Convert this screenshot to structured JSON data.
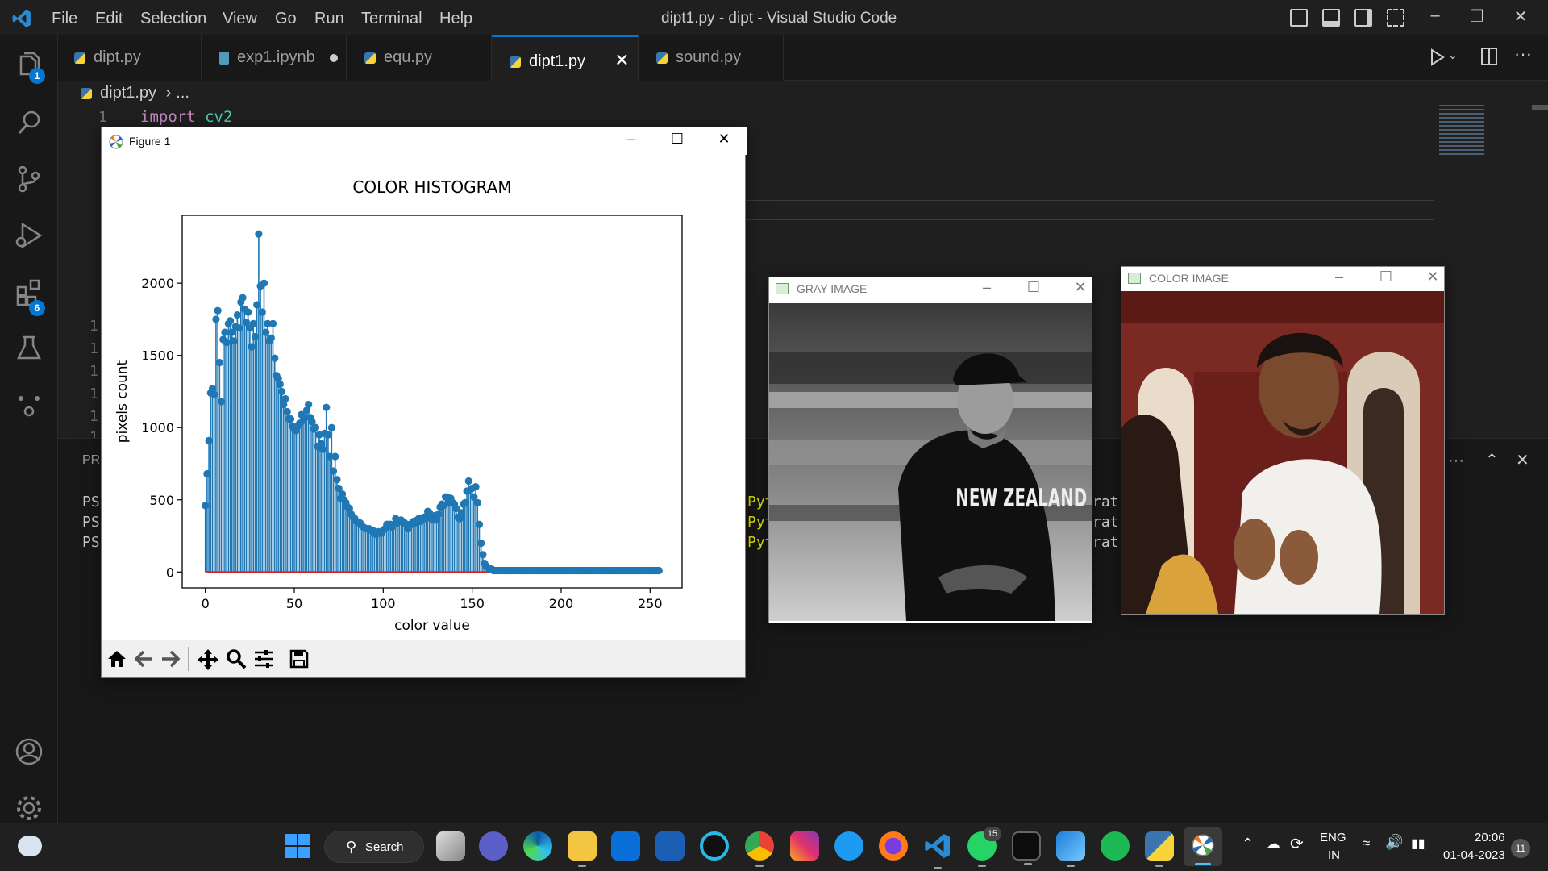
{
  "titlebar": {
    "menus": [
      "File",
      "Edit",
      "Selection",
      "View",
      "Go",
      "Run",
      "Terminal",
      "Help"
    ],
    "window_title": "dipt1.py - dipt - Visual Studio Code"
  },
  "activity": {
    "explorer_badge": "1",
    "extensions_badge": "6"
  },
  "tabs": [
    {
      "label": "dipt.py",
      "kind": "python"
    },
    {
      "label": "exp1.ipynb",
      "kind": "notebook",
      "dirty": true
    },
    {
      "label": "equ.py",
      "kind": "python"
    },
    {
      "label": "dipt1.py",
      "kind": "python",
      "active": true
    },
    {
      "label": "sound.py",
      "kind": "python"
    }
  ],
  "breadcrumb": {
    "file": "dipt1.py",
    "rest": "..."
  },
  "editor": {
    "line1_number": "1",
    "line1_keyword": "import",
    "line1_module": "cv2",
    "hidden_line_numbers": [
      "1",
      "1",
      "1",
      "1",
      "1",
      "1"
    ]
  },
  "panel": {
    "tab_prefix": "PR",
    "prompt_prefix": "PS",
    "py_fragment": "Pyt",
    "rat_fragment": "rat"
  },
  "figure": {
    "window_title": "Figure 1",
    "toolbar_icons": [
      "home-icon",
      "back-icon",
      "forward-icon",
      "pan-icon",
      "zoom-icon",
      "configure-icon",
      "save-icon"
    ]
  },
  "chart_data": {
    "type": "stem",
    "title": "COLOR HISTOGRAM",
    "xlabel": "color value",
    "ylabel": "pixels count",
    "xlim": [
      -13,
      268
    ],
    "ylim": [
      -110,
      2470
    ],
    "xticks": [
      0,
      50,
      100,
      150,
      200,
      250
    ],
    "yticks": [
      0,
      500,
      1000,
      1500,
      2000
    ],
    "stem_color": "#1f77b4",
    "baseline_color": "#d62728",
    "x": [
      0,
      1,
      2,
      3,
      4,
      5,
      6,
      7,
      8,
      9,
      10,
      11,
      12,
      13,
      14,
      15,
      16,
      17,
      18,
      19,
      20,
      21,
      22,
      23,
      24,
      25,
      26,
      27,
      28,
      29,
      30,
      31,
      32,
      33,
      34,
      35,
      36,
      37,
      38,
      39,
      40,
      41,
      42,
      43,
      44,
      45,
      46,
      47,
      48,
      49,
      50,
      51,
      52,
      53,
      54,
      55,
      56,
      57,
      58,
      59,
      60,
      61,
      62,
      63,
      64,
      65,
      66,
      67,
      68,
      69,
      70,
      71,
      72,
      73,
      74,
      75,
      76,
      77,
      78,
      79,
      80,
      81,
      82,
      83,
      84,
      85,
      86,
      87,
      88,
      89,
      90,
      91,
      92,
      93,
      94,
      95,
      96,
      97,
      98,
      99,
      100,
      101,
      102,
      103,
      104,
      105,
      106,
      107,
      108,
      109,
      110,
      111,
      112,
      113,
      114,
      115,
      116,
      117,
      118,
      119,
      120,
      121,
      122,
      123,
      124,
      125,
      126,
      127,
      128,
      129,
      130,
      131,
      132,
      133,
      134,
      135,
      136,
      137,
      138,
      139,
      140,
      141,
      142,
      143,
      144,
      145,
      146,
      147,
      148,
      149,
      150,
      151,
      152,
      153,
      154,
      155,
      156,
      157,
      158,
      159,
      160,
      161,
      162,
      163,
      164,
      165,
      166,
      167,
      168,
      169,
      170,
      171,
      172,
      173,
      174,
      175,
      176,
      177,
      178,
      179,
      180,
      181,
      182,
      183,
      184,
      185,
      186,
      187,
      188,
      189,
      190,
      191,
      192,
      193,
      194,
      195,
      196,
      197,
      198,
      199,
      200,
      201,
      202,
      203,
      204,
      205,
      206,
      207,
      208,
      209,
      210,
      211,
      212,
      213,
      214,
      215,
      216,
      217,
      218,
      219,
      220,
      221,
      222,
      223,
      224,
      225,
      226,
      227,
      228,
      229,
      230,
      231,
      232,
      233,
      234,
      235,
      236,
      237,
      238,
      239,
      240,
      241,
      242,
      243,
      244,
      245,
      246,
      247,
      248,
      249,
      250,
      251,
      252,
      253,
      254,
      255
    ],
    "y": [
      460,
      680,
      910,
      1240,
      1270,
      1230,
      1750,
      1810,
      1450,
      1180,
      1610,
      1660,
      1590,
      1720,
      1740,
      1660,
      1600,
      1700,
      1780,
      1690,
      1870,
      1900,
      1820,
      1730,
      1800,
      1690,
      1560,
      1720,
      1630,
      1850,
      2340,
      1980,
      1800,
      2000,
      1660,
      1720,
      1600,
      1620,
      1720,
      1480,
      1360,
      1340,
      1300,
      1250,
      1160,
      1200,
      1110,
      1060,
      1060,
      1010,
      990,
      980,
      1010,
      1030,
      1090,
      1050,
      1070,
      1120,
      1160,
      1070,
      1040,
      990,
      1000,
      870,
      950,
      890,
      850,
      960,
      1140,
      950,
      800,
      1000,
      700,
      800,
      640,
      580,
      510,
      540,
      500,
      480,
      450,
      440,
      400,
      380,
      370,
      350,
      340,
      340,
      320,
      310,
      300,
      300,
      300,
      290,
      290,
      270,
      260,
      280,
      270,
      270,
      290,
      300,
      330,
      330,
      330,
      310,
      330,
      370,
      340,
      350,
      360,
      350,
      340,
      330,
      300,
      330,
      330,
      350,
      340,
      360,
      370,
      350,
      370,
      380,
      370,
      420,
      410,
      370,
      360,
      390,
      360,
      400,
      450,
      470,
      460,
      520,
      520,
      480,
      510,
      480,
      470,
      440,
      380,
      370,
      410,
      470,
      480,
      560,
      630,
      570,
      580,
      520,
      590,
      480,
      330,
      200,
      120,
      60,
      40,
      30,
      20,
      20,
      10,
      10,
      10,
      10,
      10,
      10,
      10,
      10,
      10,
      10,
      10,
      10,
      10,
      10,
      10,
      10,
      10,
      10,
      10,
      10,
      10,
      10,
      10,
      10,
      10,
      10,
      10,
      10,
      10,
      10,
      10,
      10,
      10,
      10,
      10,
      10,
      10,
      10,
      10,
      10,
      10,
      10,
      10,
      10,
      10,
      10,
      10,
      10,
      10,
      10,
      10,
      10,
      10,
      10,
      10,
      10,
      10,
      10,
      10,
      10,
      10,
      10,
      10,
      10,
      10,
      10,
      10,
      10,
      10,
      10,
      10,
      10,
      10,
      10,
      10,
      10,
      10,
      10,
      10,
      10,
      10,
      10,
      10,
      10,
      10,
      10,
      10,
      10,
      10,
      10,
      10,
      10,
      10,
      10,
      10,
      10,
      10,
      10,
      10,
      10,
      10,
      10,
      10
    ]
  },
  "gray_window": {
    "title": "GRAY IMAGE",
    "jersey_text": "NEW ZEALAND"
  },
  "color_window": {
    "title": "COLOR IMAGE"
  },
  "taskbar": {
    "search_label": "Search",
    "lang_primary": "ENG",
    "lang_secondary": "IN",
    "time": "20:06",
    "date": "01-04-2023",
    "notification_count": "11",
    "whatsapp_badge": "15"
  }
}
